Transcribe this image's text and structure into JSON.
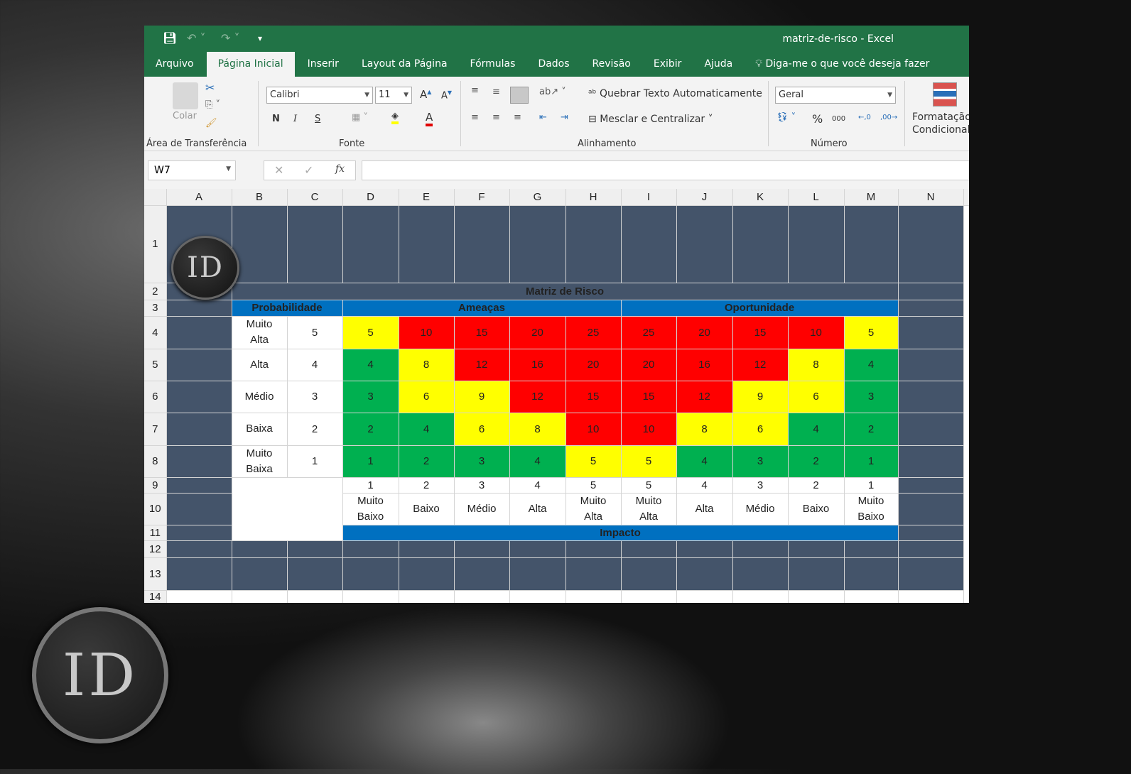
{
  "window": {
    "title": "matriz-de-risco  -  Excel"
  },
  "tabs": [
    "Arquivo",
    "Página Inicial",
    "Inserir",
    "Layout da Página",
    "Fórmulas",
    "Dados",
    "Revisão",
    "Exibir",
    "Ajuda"
  ],
  "tell_me": "Diga-me o que você deseja fazer",
  "ribbon": {
    "paste_label": "Colar",
    "clipboard_group": "Área de Transferência",
    "font_name": "Calibri",
    "font_size": "11",
    "bold": "N",
    "italic": "I",
    "underline": "S",
    "font_group": "Fonte",
    "wrap_text": "Quebrar Texto Automaticamente",
    "merge_center": "Mesclar e Centralizar",
    "alignment_group": "Alinhamento",
    "number_format": "Geral",
    "number_group": "Número",
    "percent": "%",
    "thousands": "000",
    "conditional_1": "Formatação",
    "conditional_2": "Condicional"
  },
  "formula_bar": {
    "name_box": "W7",
    "fx": "fx",
    "value": ""
  },
  "columns": [
    "A",
    "B",
    "C",
    "D",
    "E",
    "F",
    "G",
    "H",
    "I",
    "J",
    "K",
    "L",
    "M",
    "N"
  ],
  "rows": [
    "1",
    "2",
    "3",
    "4",
    "5",
    "6",
    "7",
    "8",
    "9",
    "10",
    "11",
    "12",
    "13",
    "14"
  ],
  "logo_text": "ID",
  "matrix": {
    "title": "Matriz de Risco",
    "prob_header": "Probabilidade",
    "threats_header": "Ameaças",
    "opps_header": "Oportunidade",
    "impact_header": "Impacto",
    "prob_rows": [
      {
        "label": "Muito Alta",
        "value": "5",
        "cells": [
          "5",
          "10",
          "15",
          "20",
          "25",
          "25",
          "20",
          "15",
          "10",
          "5"
        ],
        "colors": [
          "Y",
          "R",
          "R",
          "R",
          "R",
          "R",
          "R",
          "R",
          "R",
          "Y"
        ]
      },
      {
        "label": "Alta",
        "value": "4",
        "cells": [
          "4",
          "8",
          "12",
          "16",
          "20",
          "20",
          "16",
          "12",
          "8",
          "4"
        ],
        "colors": [
          "G",
          "Y",
          "R",
          "R",
          "R",
          "R",
          "R",
          "R",
          "Y",
          "G"
        ]
      },
      {
        "label": "Médio",
        "value": "3",
        "cells": [
          "3",
          "6",
          "9",
          "12",
          "15",
          "15",
          "12",
          "9",
          "6",
          "3"
        ],
        "colors": [
          "G",
          "Y",
          "Y",
          "R",
          "R",
          "R",
          "R",
          "Y",
          "Y",
          "G"
        ]
      },
      {
        "label": "Baixa",
        "value": "2",
        "cells": [
          "2",
          "4",
          "6",
          "8",
          "10",
          "10",
          "8",
          "6",
          "4",
          "2"
        ],
        "colors": [
          "G",
          "G",
          "Y",
          "Y",
          "R",
          "R",
          "Y",
          "Y",
          "G",
          "G"
        ]
      },
      {
        "label": "Muito Baixa",
        "value": "1",
        "cells": [
          "1",
          "2",
          "3",
          "4",
          "5",
          "5",
          "4",
          "3",
          "2",
          "1"
        ],
        "colors": [
          "G",
          "G",
          "G",
          "G",
          "Y",
          "Y",
          "G",
          "G",
          "G",
          "G"
        ]
      }
    ],
    "impact_values": [
      "1",
      "2",
      "3",
      "4",
      "5",
      "5",
      "4",
      "3",
      "2",
      "1"
    ],
    "impact_labels": [
      "Muito Baixo",
      "Baixo",
      "Médio",
      "Alta",
      "Muito Alta",
      "Muito Alta",
      "Alta",
      "Médio",
      "Baixo",
      "Muito Baixo"
    ],
    "palette": {
      "Y": "#ffff00",
      "R": "#ff0000",
      "G": "#00b050"
    }
  },
  "colors": {
    "excel_green": "#217346",
    "sheet_bg": "#44546a",
    "header_blue": "#0070c0"
  }
}
